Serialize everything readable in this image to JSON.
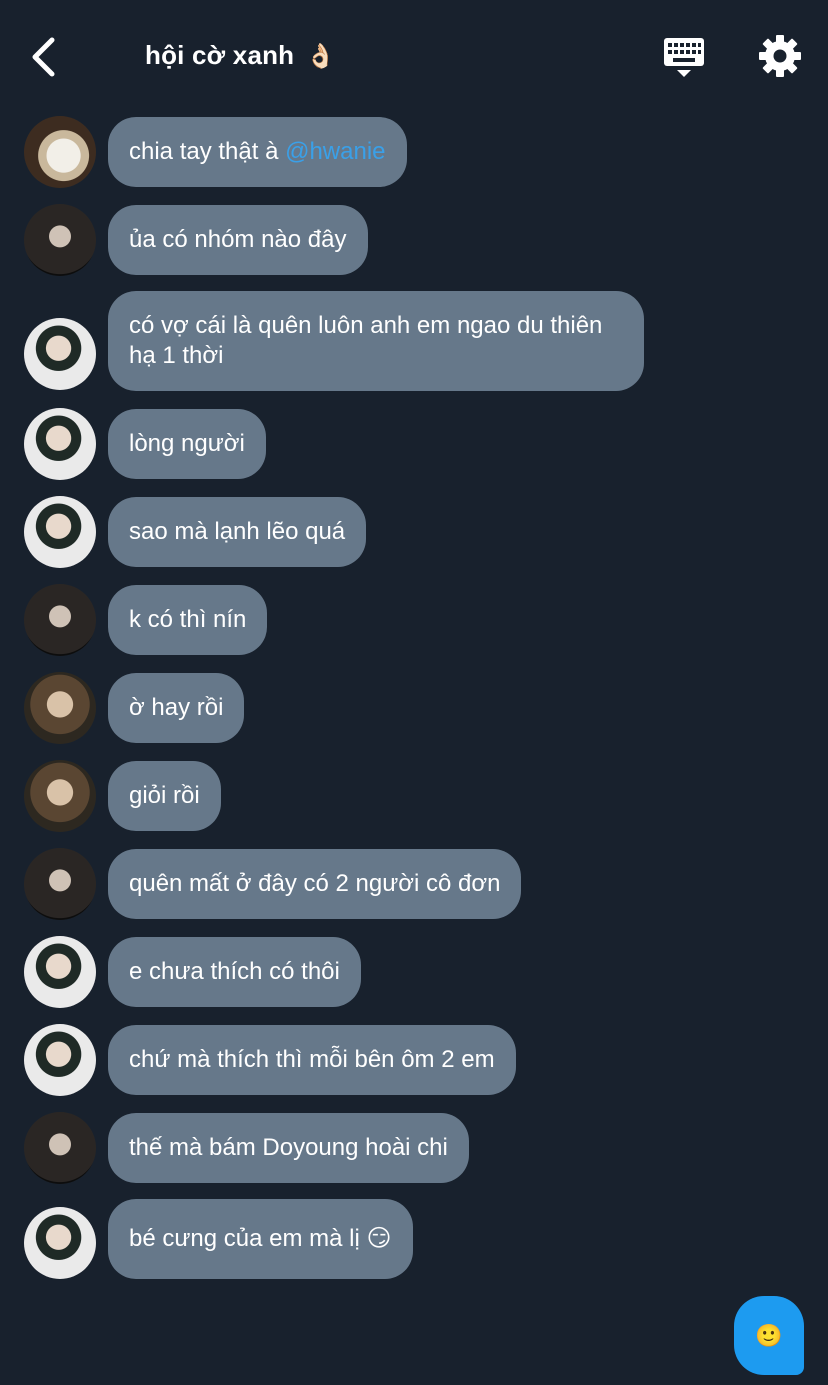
{
  "header": {
    "title": "hội cờ xanh",
    "title_emoji": "👌🏻",
    "back_icon": "chevron-left-icon",
    "keyboard_icon": "keyboard-icon",
    "settings_icon": "gear-icon"
  },
  "messages": [
    {
      "avatar": "avatar-a",
      "text": "chia tay thật à ",
      "mention": "@hwanie"
    },
    {
      "avatar": "avatar-b",
      "text": "ủa có nhóm nào đây"
    },
    {
      "avatar": "avatar-c",
      "text": "có vợ cái là quên luôn anh em ngao du thiên hạ 1 thời"
    },
    {
      "avatar": "avatar-c",
      "text": "lòng người"
    },
    {
      "avatar": "avatar-c",
      "text": "sao mà lạnh lẽo quá"
    },
    {
      "avatar": "avatar-b",
      "text": "k có thì nín"
    },
    {
      "avatar": "avatar-d",
      "text": "ờ hay rồi"
    },
    {
      "avatar": "avatar-d",
      "text": "giỏi rồi"
    },
    {
      "avatar": "avatar-b",
      "text": "quên mất ở đây có 2 người cô đơn"
    },
    {
      "avatar": "avatar-c",
      "text": "e chưa thích có thôi"
    },
    {
      "avatar": "avatar-c",
      "text": "chứ mà thích thì mỗi bên ôm 2 em"
    },
    {
      "avatar": "avatar-b",
      "text": "thế mà bám Doyoung hoài chi"
    },
    {
      "avatar": "avatar-c",
      "text": "bé cưng của em mà lị 😏"
    }
  ],
  "fab": {
    "emoji": "🙂",
    "icon": "emoji-icon"
  },
  "colors": {
    "background": "#18212d",
    "bubble": "#66788a",
    "mention": "#3aa0e8",
    "fab": "#1d9bf0"
  }
}
